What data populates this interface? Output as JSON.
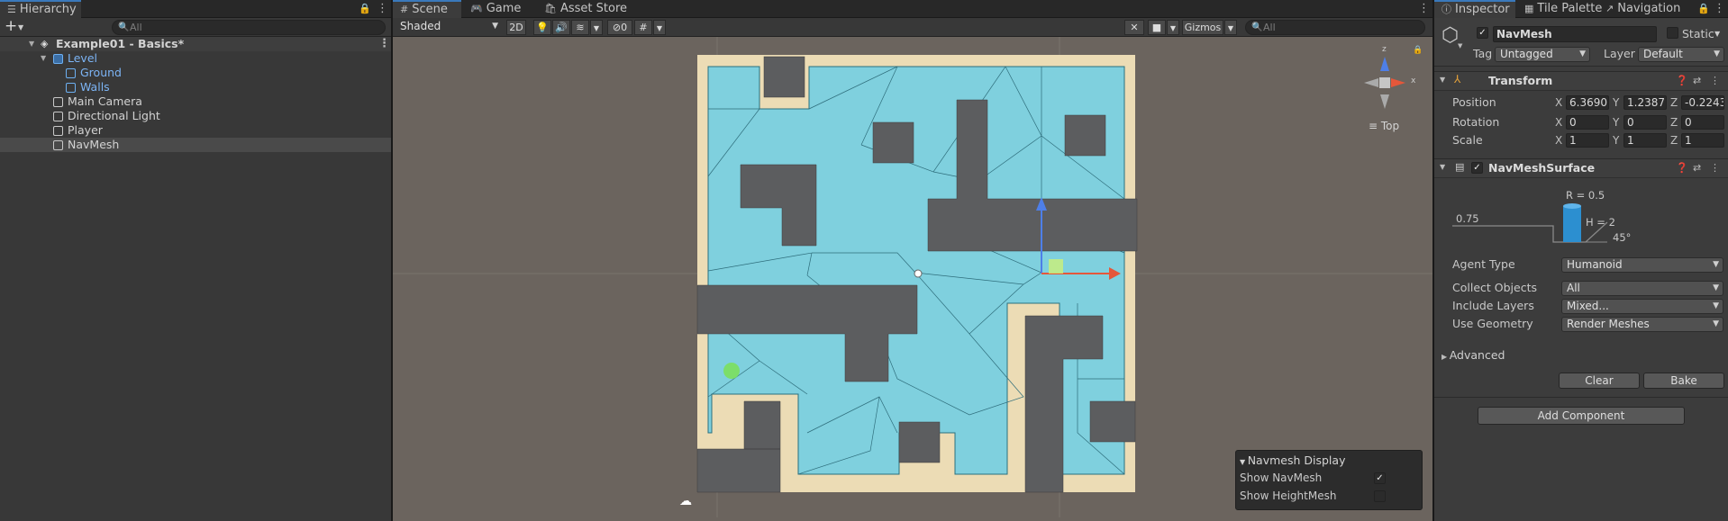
{
  "hierarchy": {
    "tab": "Hierarchy",
    "search_placeholder": "All",
    "add_label": "+",
    "scene": "Example01 - Basics*",
    "items": [
      {
        "label": "Level"
      },
      {
        "label": "Ground"
      },
      {
        "label": "Walls"
      },
      {
        "label": "Main Camera"
      },
      {
        "label": "Directional Light"
      },
      {
        "label": "Player"
      },
      {
        "label": "NavMesh"
      }
    ]
  },
  "scene_view": {
    "tabs": [
      "Scene",
      "Game",
      "Asset Store"
    ],
    "shading": "Shaded",
    "mode_2d": "2D",
    "hidden_count": "0",
    "gizmos": "Gizmos",
    "search_placeholder": "All",
    "orientation": "Top",
    "gizmo_axes": {
      "x": "x",
      "z": "z"
    },
    "overlay": {
      "title": "Navmesh Display",
      "rows": [
        {
          "label": "Show NavMesh",
          "checked": true
        },
        {
          "label": "Show HeightMesh",
          "checked": false
        }
      ]
    },
    "colors": {
      "navmesh": "#7fd0de",
      "walkable_border": "#ecdcb5",
      "wall": "#5c5d5f",
      "background": "#6b645e",
      "player": "#7cde6a"
    }
  },
  "inspector": {
    "tabs": [
      "Inspector",
      "Tile Palette",
      "Navigation"
    ],
    "object_name": "NavMesh",
    "static_label": "Static",
    "tag_label": "Tag",
    "tag_value": "Untagged",
    "layer_label": "Layer",
    "layer_value": "Default",
    "transform": {
      "title": "Transform",
      "position": {
        "label": "Position",
        "x": "6.3690",
        "y": "1.23871",
        "z": "-0.2243"
      },
      "rotation": {
        "label": "Rotation",
        "x": "0",
        "y": "0",
        "z": "0"
      },
      "scale": {
        "label": "Scale",
        "x": "1",
        "y": "1",
        "z": "1"
      }
    },
    "navmesh_surface": {
      "title": "NavMeshSurface",
      "agent_radius": "R = 0.5",
      "agent_height": "H = 2",
      "step_height": "0.75",
      "max_slope": "45°",
      "agent_type": {
        "label": "Agent Type",
        "value": "Humanoid"
      },
      "collect_objects": {
        "label": "Collect Objects",
        "value": "All"
      },
      "include_layers": {
        "label": "Include Layers",
        "value": "Mixed..."
      },
      "use_geometry": {
        "label": "Use Geometry",
        "value": "Render Meshes"
      },
      "advanced": "Advanced",
      "clear": "Clear",
      "bake": "Bake"
    },
    "add_component": "Add Component"
  }
}
